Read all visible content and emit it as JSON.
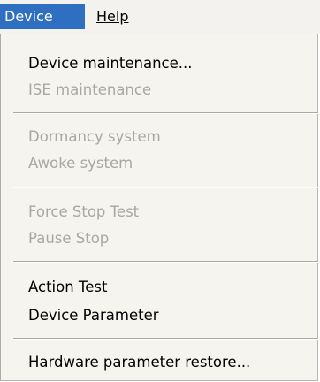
{
  "menubar": {
    "device": {
      "label": "Device"
    },
    "help": {
      "label": "Help"
    }
  },
  "menu": {
    "items": [
      {
        "label": "Device maintenance...",
        "enabled": true
      },
      {
        "label": "ISE maintenance",
        "enabled": false
      },
      {
        "label": "Dormancy system",
        "enabled": false
      },
      {
        "label": "Awoke system",
        "enabled": false
      },
      {
        "label": "Force Stop Test",
        "enabled": false
      },
      {
        "label": "Pause Stop",
        "enabled": false
      },
      {
        "label": "Action Test",
        "enabled": true
      },
      {
        "label": "Device Parameter",
        "enabled": true
      },
      {
        "label": "Hardware parameter restore...",
        "enabled": true
      }
    ]
  },
  "colors": {
    "menubar_active_bg": "#2f6fc1",
    "menu_bg": "#f5f4ef",
    "disabled_text": "#a8a7a1"
  }
}
